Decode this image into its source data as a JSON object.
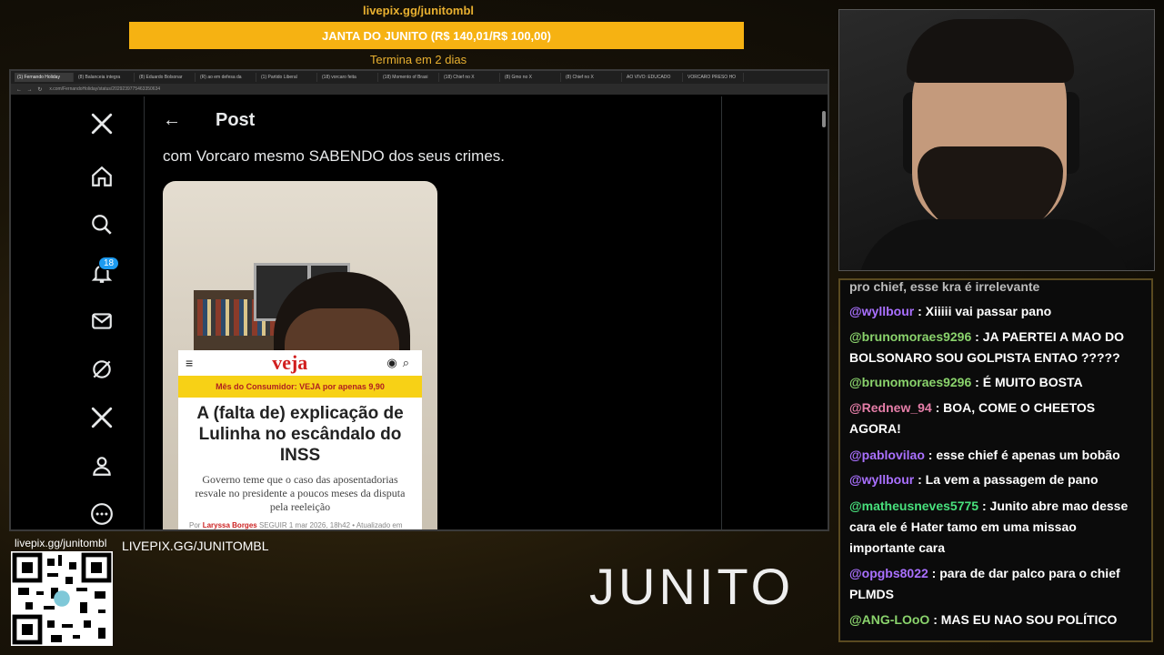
{
  "overlay": {
    "top_url": "livepix.gg/junitombl",
    "goal_text": "JANTA DO JUNITO (R$ 140,01/R$ 100,00)",
    "goal_subtext": "Termina em 2 dias",
    "qr_label": "livepix.gg/junitombl",
    "livepix_large": "LIVEPIX.GG/JUNITOMBL",
    "logo_text": "JUNITO"
  },
  "browser": {
    "tabs": [
      "(1) Fernando Holiday",
      "(8) Balanceia integra",
      "(8) Eduardo Bolsonar",
      "(R) ao em defesa da",
      "(1) Partido Liberal",
      "(18) vorcaro feita",
      "(18) Momento of Brasi",
      "(18) Chief no X",
      "(8) Gmo no X",
      "(8) Chief no X",
      "AO VIVO: EDUCADO",
      "VORCARO PRESO HO"
    ],
    "url": "x.com/FernandoHoliday/status/2029239775463350634",
    "nav_icons": "← → ↻"
  },
  "x": {
    "sidebar": {
      "notification_count": "18"
    },
    "post": {
      "header_title": "Post",
      "text": "com Vorcaro mesmo SABENDO dos seus crimes."
    },
    "veja": {
      "logo": "veja",
      "promo": "Mês do Consumidor: VEJA por apenas 9,90",
      "headline": "A (falta de) explicação de Lulinha no escândalo do INSS",
      "deck": "Governo teme que o caso das aposentadorias resvale no presidente a poucos meses da disputa pela reeleição",
      "byline_prefix": "Por",
      "author": "Laryssa Borges",
      "follow": "SEGUIR",
      "date": "1 mar 2026, 18h42 • Atualizado em"
    }
  },
  "chat": {
    "cut_line": "pro chief, esse kra é irrelevante",
    "messages": [
      {
        "user": "@wyllbour",
        "text": "Xiiiii vai passar pano"
      },
      {
        "user": "@brunomoraes9296",
        "text": "JA PAERTEI A MAO DO BOLSONARO SOU GOLPISTA ENTAO ?????"
      },
      {
        "user": "@brunomoraes9296",
        "text": "É MUITO BOSTA"
      },
      {
        "user": "@Rednew_94",
        "text": "BOA, COME O CHEETOS AGORA!"
      },
      {
        "user": "@pablovilao",
        "text": "esse chief é apenas um bobão"
      },
      {
        "user": "@wyllbour",
        "text": "La vem a passagem de pano"
      },
      {
        "user": "@matheusneves5775",
        "text": "Junito abre mao desse cara ele é Hater tamo em uma missao importante cara"
      },
      {
        "user": "@opgbs8022",
        "text": "para de dar palco para o chief PLMDS"
      },
      {
        "user": "@ANG-LOoO",
        "text": "MAS EU NAO SOU POLÍTICO"
      }
    ]
  },
  "colors": {
    "goal_bar": "#f6b212",
    "accent_gold": "#e8b030",
    "x_blue": "#1d9bf0",
    "veja_red": "#d11f1f",
    "veja_yellow": "#f7d116"
  },
  "icons": [
    "x-logo-icon",
    "home-icon",
    "search-icon",
    "bell-icon",
    "mail-icon",
    "grok-icon",
    "x-premium-icon",
    "profile-icon",
    "more-icon",
    "back-arrow-icon"
  ]
}
